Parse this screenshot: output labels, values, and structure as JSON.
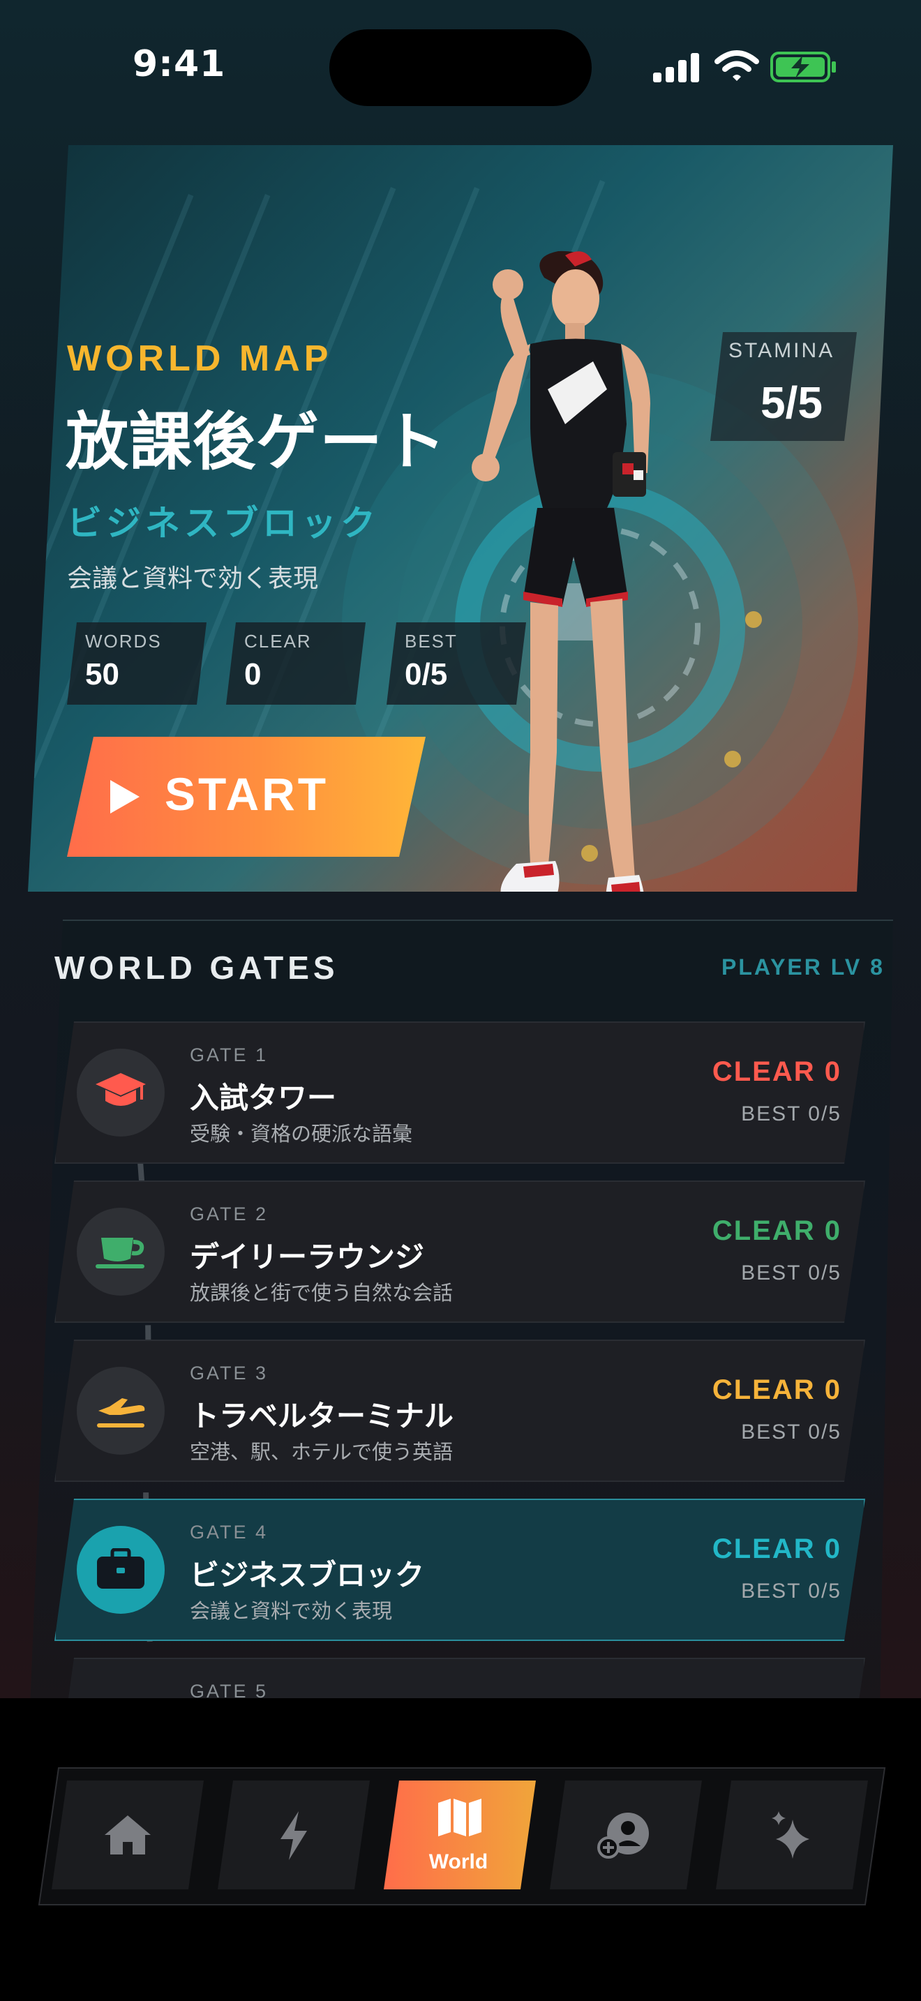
{
  "status_bar": {
    "time": "9:41"
  },
  "hero": {
    "kicker": "WORLD MAP",
    "title": "放課後ゲート",
    "subtitle": "ビジネスブロック",
    "description": "会議と資料で効く表現",
    "stamina_label": "STAMINA",
    "stamina_value": "5/5",
    "stats": [
      {
        "label": "WORDS",
        "value": "50"
      },
      {
        "label": "CLEAR",
        "value": "0"
      },
      {
        "label": "BEST",
        "value": "0/5"
      }
    ],
    "start_label": "START"
  },
  "gates_panel": {
    "title": "WORLD GATES",
    "player_level": "PLAYER LV 8",
    "gates": [
      {
        "number": "GATE 1",
        "name": "入試タワー",
        "desc": "受験・資格の硬派な語彙",
        "clear": "CLEAR 0",
        "best": "BEST 0/5",
        "icon": "graduation-cap-icon",
        "color": "#ff5a4e"
      },
      {
        "number": "GATE 2",
        "name": "デイリーラウンジ",
        "desc": "放課後と街で使う自然な会話",
        "clear": "CLEAR 0",
        "best": "BEST 0/5",
        "icon": "coffee-cup-icon",
        "color": "#3fae6b"
      },
      {
        "number": "GATE 3",
        "name": "トラベルターミナル",
        "desc": "空港、駅、ホテルで使う英語",
        "clear": "CLEAR 0",
        "best": "BEST 0/5",
        "icon": "airplane-icon",
        "color": "#f6b33a"
      },
      {
        "number": "GATE 4",
        "name": "ビジネスブロック",
        "desc": "会議と資料で効く表現",
        "clear": "CLEAR 0",
        "best": "BEST 0/5",
        "icon": "briefcase-icon",
        "color": "#22b7c7"
      },
      {
        "number": "GATE 5"
      }
    ]
  },
  "nav": {
    "tabs": [
      {
        "name": "home",
        "icon": "home-icon"
      },
      {
        "name": "bolt",
        "icon": "lightning-icon"
      },
      {
        "name": "world",
        "icon": "map-icon",
        "label": "World",
        "active": true
      },
      {
        "name": "friends",
        "icon": "add-user-icon"
      },
      {
        "name": "sparkle",
        "icon": "sparkle-icon"
      }
    ],
    "world_label": "World"
  },
  "colors": {
    "accent_orange": "#ff6d4a",
    "accent_yellow": "#f7b62e",
    "accent_teal": "#2fb6c2"
  }
}
